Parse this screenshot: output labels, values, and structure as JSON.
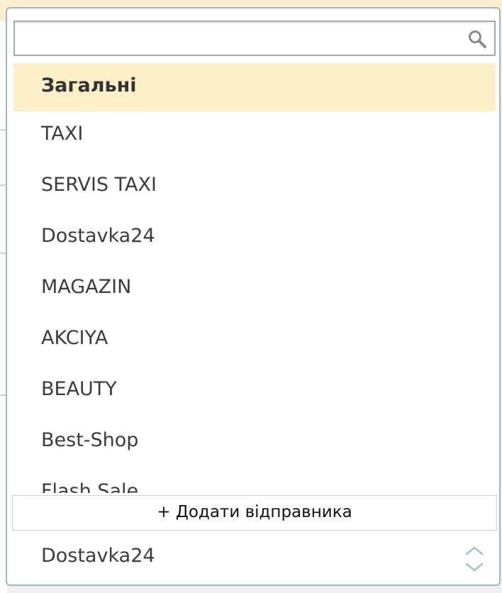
{
  "search": {
    "value": "",
    "placeholder": ""
  },
  "sender_list": {
    "items": [
      {
        "label": "Загальні",
        "selected": true
      },
      {
        "label": "TAXI"
      },
      {
        "label": "SERVIS TAXI"
      },
      {
        "label": "Dostavka24"
      },
      {
        "label": "MAGAZIN"
      },
      {
        "label": "AKCIYA"
      },
      {
        "label": "BEAUTY"
      },
      {
        "label": "Best-Shop"
      },
      {
        "label": "Flash Sale"
      }
    ]
  },
  "add_sender_label": "+ Додати відправника",
  "current_selection": "Dostavka24",
  "colors": {
    "selected_row": "#fbefc8",
    "border": "#9fb6bd",
    "stepper": "#9fc2cc"
  },
  "icons": {
    "search": "search-icon",
    "stepper_up": "chevron-up-icon",
    "stepper_down": "chevron-down-icon"
  }
}
